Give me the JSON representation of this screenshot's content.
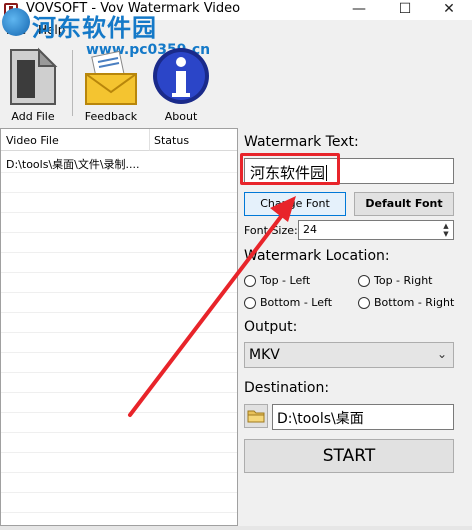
{
  "window": {
    "title": "VOVSOFT - Vov Watermark Video",
    "minimize_glyph": "—",
    "maximize_glyph": "☐",
    "close_glyph": "✕"
  },
  "overlay_watermark": {
    "logo_text": "河东软件园",
    "url_text": "www.pc0359.cn"
  },
  "menu": {
    "file": "File",
    "help": "Help"
  },
  "toolbar": {
    "add_file": "Add File",
    "feedback": "Feedback",
    "about": "About"
  },
  "file_list": {
    "columns": [
      "Video File",
      "Status"
    ],
    "rows": [
      {
        "file": "D:\\tools\\桌面\\文件\\录制....",
        "status": ""
      }
    ]
  },
  "settings": {
    "watermark_text_label": "Watermark Text:",
    "watermark_text_value": "河东软件园",
    "change_font": "Change Font",
    "default_font": "Default Font",
    "font_size_label": "Font Size:",
    "font_size_value": "24",
    "location_label": "Watermark Location:",
    "locations": {
      "top_left": "Top - Left",
      "top_right": "Top - Right",
      "bottom_left": "Bottom - Left",
      "bottom_right": "Bottom - Right"
    },
    "output_label": "Output:",
    "output_value": "MKV",
    "destination_label": "Destination:",
    "destination_value": "D:\\tools\\桌面",
    "start": "START"
  },
  "colors": {
    "highlight_red": "#e8242a",
    "watermark_blue": "#1479c8",
    "focus_blue": "#0078d7"
  }
}
